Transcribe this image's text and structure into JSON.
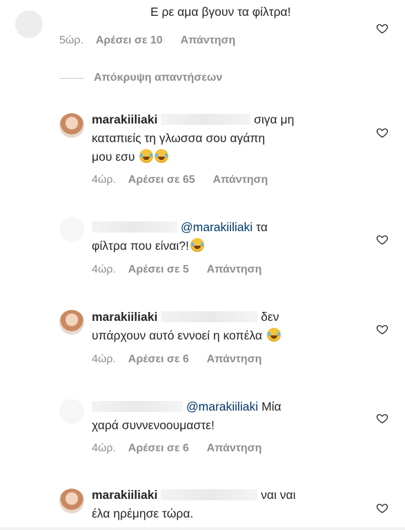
{
  "comments": [
    {
      "text": "Ε ρε αμα βγουν τα φίλτρα!",
      "time": "5ώρ.",
      "likes": "Αρέσει σε 10",
      "reply": "Απάντηση"
    },
    {
      "username": "marakiiliaki",
      "line1": "σιγα μη",
      "line2": "καταπιείς τη γλωσσα σου αγάπη",
      "line3": "μου εσυ",
      "time": "4ώρ.",
      "likes": "Αρέσει σε 65",
      "reply": "Απάντηση"
    },
    {
      "mention": "@marakiiliaki",
      "line1_tail": "τα",
      "line2": "φίλτρα που είναι?!",
      "time": "4ώρ.",
      "likes": "Αρέσει σε 5",
      "reply": "Απάντηση"
    },
    {
      "username": "marakiiliaki",
      "line1": "δεν",
      "line2": "υπάρχουν αυτό εννοεί η κοπέλα",
      "time": "4ώρ.",
      "likes": "Αρέσει σε 6",
      "reply": "Απάντηση"
    },
    {
      "mention": "@marakiiliaki",
      "line1_tail": "Μία",
      "line2": "χαρά συννενοουμαστε!",
      "time": "4ώρ.",
      "likes": "Αρέσει σε 6",
      "reply": "Απάντηση"
    },
    {
      "username": "marakiiliaki",
      "line1": "ναι ναι",
      "line2": "έλα ηρέμησε τώρα."
    }
  ],
  "hide_replies_label": "Απόκρυψη απαντήσεων",
  "icons": {
    "like": "heart-outline-icon",
    "emoji": "face-with-tears-of-joy-emoji"
  },
  "colors": {
    "text": "#262626",
    "meta": "#8e8e8e",
    "mention": "#00376b"
  }
}
